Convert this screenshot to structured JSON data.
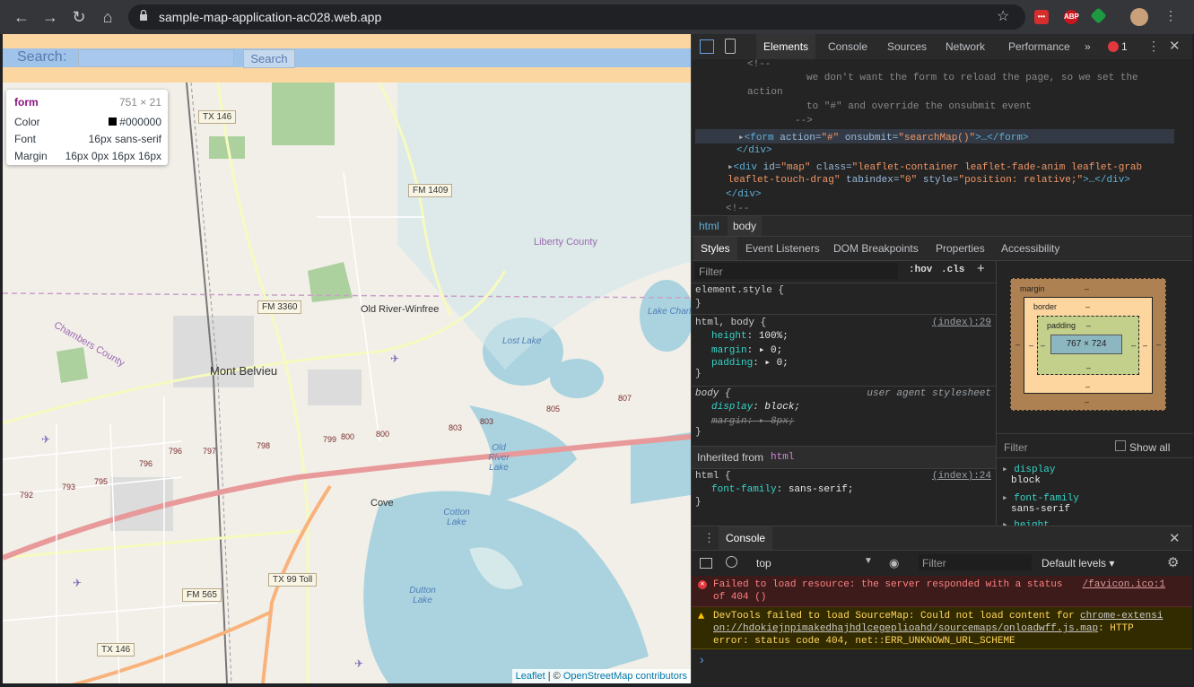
{
  "browser": {
    "url": "sample-map-application-ac028.web.app",
    "ext_labels": [
      "ABP"
    ]
  },
  "page": {
    "search_label": "Search:",
    "search_button": "Search",
    "tooltip": {
      "tag": "form",
      "size": "751 × 21",
      "color_label": "Color",
      "color_value": "#000000",
      "font_label": "Font",
      "font_value": "16px sans-serif",
      "margin_label": "Margin",
      "margin_value": "16px 0px 16px 16px"
    },
    "attribution": {
      "leaflet": "Leaflet",
      "sep": " | © ",
      "osm": "OpenStreetMap contributors"
    },
    "map_labels": {
      "tx146_top": "TX 146",
      "fm1409": "FM 1409",
      "fm3360": "FM 3360",
      "old_river": "Old River-Winfree",
      "mont_belvieu": "Mont Belvieu",
      "cove": "Cove",
      "fm565": "FM 565",
      "tx99": "TX 99 Toll",
      "tx146_bottom": "TX 146",
      "liberty": "Liberty County",
      "chambers": "Chambers County",
      "lost_lake": "Lost Lake",
      "lake_charl": "Lake Charl",
      "old_river_lake": "Old River Lake",
      "cotton_lake": "Cotton Lake",
      "dutton_lake": "Dutton Lake",
      "exits": [
        "792",
        "793",
        "795",
        "796",
        "796",
        "797",
        "798",
        "799",
        "800",
        "800",
        "803",
        "803",
        "805",
        "807"
      ]
    }
  },
  "devtools": {
    "tabs": [
      "Elements",
      "Console",
      "Sources",
      "Network",
      "Performance"
    ],
    "more": "»",
    "error_count": "1",
    "elements": {
      "lines": [
        "<!--",
        "we don't want the form to reload the page, so we set the",
        "action",
        "to \"#\" and override the onsubmit event",
        "-->",
        "</div>",
        "</div>",
        "<!--"
      ],
      "form_line": {
        "tag_open": "<form",
        "attr1": " action=",
        "val1": "\"#\"",
        "attr2": " onsubmit=",
        "val2": "\"searchMap()\"",
        "rest": ">…</form>"
      },
      "div_line1": {
        "tag_open": "<div",
        "attr1": " id=",
        "val1": "\"map\"",
        "attr2": " class=",
        "val2": "\"leaflet-container leaflet-fade-anim leaflet-grab"
      },
      "div_line2": {
        "val2b": "leaflet-touch-drag\"",
        "attr3": " tabindex=",
        "val3": "\"0\"",
        "attr4": " style=",
        "val4": "\"position: relative;\"",
        "rest": ">…</div>"
      }
    },
    "breadcrumbs": [
      "html",
      "body"
    ],
    "subtabs": [
      "Styles",
      "Event Listeners",
      "DOM Breakpoints",
      "Properties",
      "Accessibility"
    ],
    "filter_placeholder": "Filter",
    "hov": ":hov",
    "cls": ".cls",
    "plus": "+",
    "styles": {
      "element_style": "element.style {",
      "close": "}",
      "rule1_selector": "html, body {",
      "rule1_src": "(index):29",
      "rule1_props": [
        {
          "name": "height",
          "value": "100%;"
        },
        {
          "name": "margin",
          "value": "▸ 0;"
        },
        {
          "name": "padding",
          "value": "▸ 0;"
        }
      ],
      "rule2_selector": "body {",
      "rule2_src": "user agent stylesheet",
      "rule2_props": [
        {
          "name": "display",
          "value": "block;"
        },
        {
          "name": "margin",
          "value": "▸ 8px;"
        }
      ],
      "inherited": "Inherited from",
      "inherited_tag": "html",
      "rule3_selector": "html {",
      "rule3_src": "(index):24",
      "rule3_props": [
        {
          "name": "font-family",
          "value": "sans-serif;"
        }
      ]
    },
    "boxmodel": {
      "margin": "margin",
      "border": "border",
      "padding": "padding",
      "content": "767 × 724",
      "dash": "–"
    },
    "computed": {
      "filter": "Filter",
      "show_all": "Show all",
      "items": [
        {
          "name": "display",
          "value": "block"
        },
        {
          "name": "font-family",
          "value": "sans-serif"
        },
        {
          "name": "height",
          "value": ""
        }
      ]
    },
    "console": {
      "tab": "Console",
      "context": "top",
      "filter": "Filter",
      "levels": "Default levels ▾",
      "msg1": "Failed to load resource: the server responded with a status",
      "msg1b": "of 404 ()",
      "msg1_src": "/favicon.ico:1",
      "msg2a": "DevTools failed to load SourceMap: Could not load content for",
      "msg2_link1": "chrome-extensi",
      "msg2_link2": "on://hdokiejnpimakedhajhdlcegeplioahd/sourcemaps/onloadwff.js.map",
      "msg2b": ": HTTP",
      "msg2c": "error: status code 404, net::ERR_UNKNOWN_URL_SCHEME",
      "prompt": "›"
    }
  }
}
